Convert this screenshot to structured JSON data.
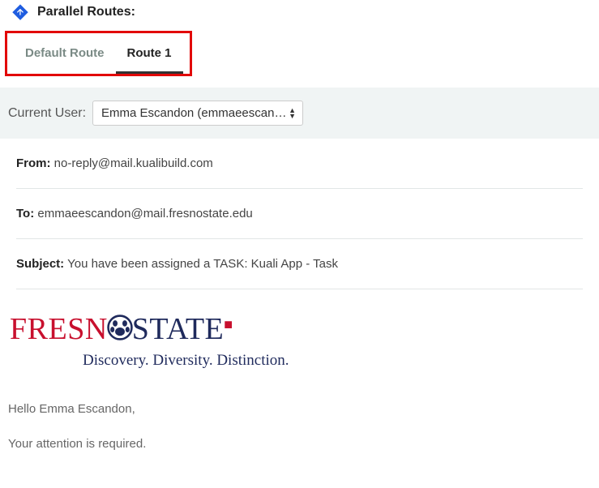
{
  "header": {
    "title": "Parallel Routes:"
  },
  "tabs": [
    {
      "label": "Default Route",
      "active": false
    },
    {
      "label": "Route 1",
      "active": true
    }
  ],
  "user_bar": {
    "label": "Current User:",
    "selected": "Emma Escandon (emmaeescan…"
  },
  "email": {
    "from_label": "From:",
    "from_value": "no-reply@mail.kualibuild.com",
    "to_label": "To:",
    "to_value": "emmaeescandon@mail.fresnostate.edu",
    "subject_label": "Subject:",
    "subject_value": "You have been assigned a TASK: Kuali App - Task"
  },
  "logo": {
    "part1": "FRESN",
    "part2": "STATE",
    "tagline": "Discovery. Diversity. Distinction."
  },
  "body": {
    "greeting": "Hello Emma Escandon,",
    "line1": "Your attention is required."
  }
}
